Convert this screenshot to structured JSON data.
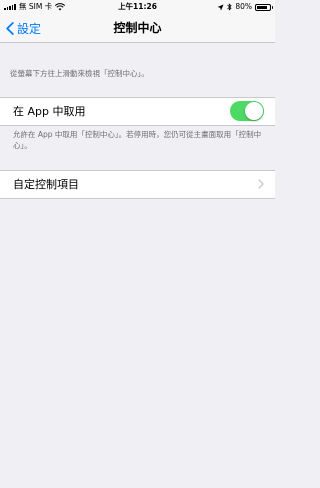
{
  "status_bar": {
    "carrier": "無 SIM 卡",
    "time": "上午11:26",
    "battery_percent": "80%",
    "battery_level": 0.8
  },
  "nav": {
    "back_label": "設定",
    "title": "控制中心"
  },
  "content": {
    "hint_text": "從螢幕下方往上滑動來檢視「控制中心」。",
    "access_in_apps": {
      "label": "在 App 中取用",
      "enabled": true,
      "footer": "允許在 App 中取用「控制中心」。若停用時，您仍可從主畫面取用「控制中心」。"
    },
    "customize_label": "自定控制項目"
  },
  "colors": {
    "accent": "#007aff",
    "toggle_on": "#4cd964",
    "background": "#efeff4"
  }
}
